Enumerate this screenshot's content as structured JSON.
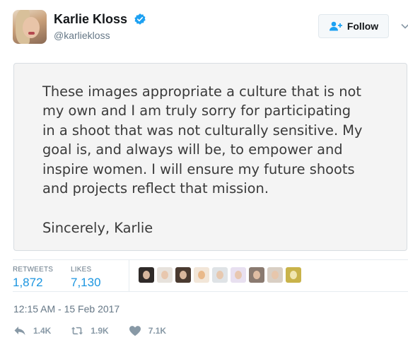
{
  "author": {
    "display_name": "Karlie Kloss",
    "handle": "@karliekloss",
    "verified": true,
    "follow_label": "Follow"
  },
  "statement": {
    "lines": [
      "These images appropriate a culture that is not",
      "my own and I am truly sorry for participating",
      "in a shoot that was not culturally sensitive. My",
      "goal is, and always will be, to empower and",
      "inspire women. I will ensure my future shoots",
      "and projects reflect that mission."
    ],
    "signoff": "Sincerely, Karlie"
  },
  "stats": {
    "retweets_label": "RETWEETS",
    "retweets_value": "1,872",
    "likes_label": "LIKES",
    "likes_value": "7,130"
  },
  "liker_avatars": [
    "avatar-1",
    "avatar-2",
    "avatar-3",
    "avatar-4",
    "avatar-5",
    "avatar-6",
    "avatar-7",
    "avatar-8",
    "avatar-9"
  ],
  "timestamp": "12:15 AM - 15 Feb 2017",
  "actions": {
    "reply_count": "1.4K",
    "retweet_count": "1.9K",
    "like_count": "7.1K"
  },
  "colors": {
    "accent_blue": "#1b95e0",
    "verified_blue": "#1da1f2",
    "muted": "#657786",
    "card_bg": "#f4f4f4"
  }
}
